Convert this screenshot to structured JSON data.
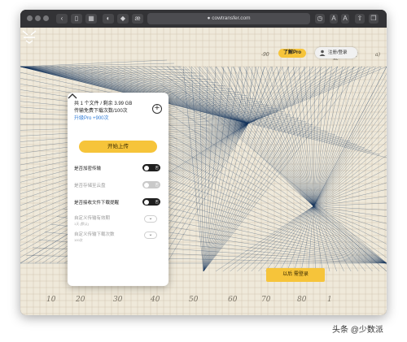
{
  "browser": {
    "address": "cowtransfer.com"
  },
  "header": {
    "pro_button": "了解Pro",
    "user_chip": "注册/登录",
    "handwritten_top": [
      "-90",
      "xc",
      "Y[",
      "a)"
    ]
  },
  "panel": {
    "summary": "共 1 个文件 / 剩余 3.99 GB",
    "quota": "传输免费下载次数/100次",
    "upgrade_link": "升级Pro +900次",
    "upload_button": "开始上传",
    "options": [
      {
        "label": "是否加密传输",
        "toggle_text": "否",
        "state": "on"
      },
      {
        "label": "是否存储至云盘",
        "toggle_text": "否",
        "state": "off"
      },
      {
        "label": "是否接收文件下载提醒",
        "toggle_text": "否",
        "state": "on"
      }
    ],
    "selects": [
      {
        "label": "自定义传输有效期",
        "sub": "1天 (默认)"
      },
      {
        "label": "自定义传输下载次数",
        "sub": "100次"
      }
    ]
  },
  "login_button": "以后 需登录",
  "ruler_labels": [
    "10",
    "20",
    "30",
    "40",
    "50",
    "60",
    "70",
    "80",
    "1"
  ],
  "watermark": "头条 @少数派",
  "colors": {
    "accent": "#f6c43a",
    "link": "#2f7bd6",
    "line_art": "#17355d",
    "paper": "#efe9da"
  },
  "icons": {
    "logo": "cowtransfer-logo-icon",
    "add": "plus-circle-icon",
    "user": "user-icon",
    "collapse": "chevron-up-icon"
  }
}
